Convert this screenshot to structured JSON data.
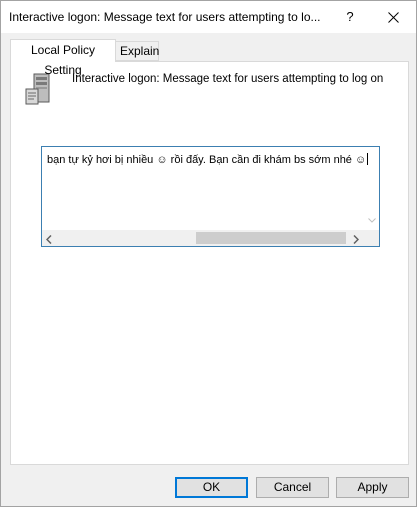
{
  "window": {
    "title": "Interactive logon: Message text for users attempting to lo...",
    "help_label": "?"
  },
  "tabs": [
    {
      "label": "Local Policy Setting"
    },
    {
      "label": "Explain"
    }
  ],
  "policy": {
    "icon": "server-policy-icon",
    "title": "Interactive logon: Message text for users attempting to log on"
  },
  "textbox": {
    "value_part1": "bạn tự kỷ hơi bị nhiều ",
    "emoji1": "☺",
    "value_part2": " rồi đấy. Bạn cần đi khám bs sớm nhé ",
    "emoji2": "☺"
  },
  "buttons": {
    "ok": "OK",
    "cancel": "Cancel",
    "apply": "Apply"
  },
  "colors": {
    "accent": "#0078d7",
    "focus_border": "#3c7fb1"
  }
}
